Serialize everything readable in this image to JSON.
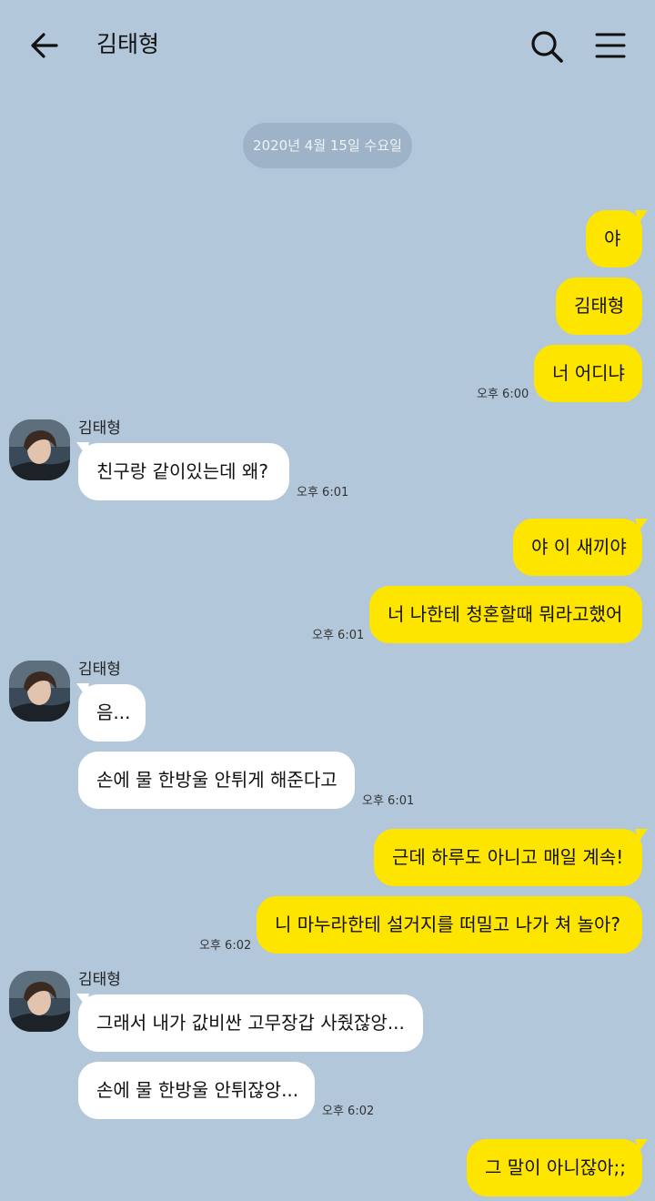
{
  "header": {
    "title": "김태형",
    "back_icon": "arrow-left-icon",
    "search_icon": "search-icon",
    "menu_icon": "hamburger-menu-icon"
  },
  "date_divider": "2020년 4월 15일 수요일",
  "colors": {
    "background": "#b2c7da",
    "my_bubble": "#fee500",
    "their_bubble": "#ffffff",
    "date_pill": "#9eb3c7"
  },
  "messages": [
    {
      "from": "me",
      "text": "야"
    },
    {
      "from": "me",
      "text": "김태형"
    },
    {
      "from": "me",
      "text": "너 어디냐",
      "time": "오후 6:00"
    },
    {
      "from": "them",
      "sender": "김태형",
      "text": "친구랑 같이있는데 왜?",
      "time": "오후 6:01"
    },
    {
      "from": "me",
      "text": "야 이 새끼야"
    },
    {
      "from": "me",
      "text": "너 나한테 청혼할때 뭐라고했어",
      "time": "오후 6:01"
    },
    {
      "from": "them",
      "sender": "김태형",
      "text": "음..."
    },
    {
      "from": "them",
      "text": "손에 물 한방울 안튀게 해준다고",
      "time": "오후 6:01"
    },
    {
      "from": "me",
      "text": "근데 하루도 아니고 매일 계속!"
    },
    {
      "from": "me",
      "text": "니 마누라한테 설거지를 떠밀고 나가 쳐 놀아?",
      "time": "오후 6:02"
    },
    {
      "from": "them",
      "sender": "김태형",
      "text": "그래서 내가 값비싼 고무장갑 사줬잖앙..."
    },
    {
      "from": "them",
      "text": "손에 물 한방울 안튀잖앙...",
      "time": "오후 6:02"
    },
    {
      "from": "me",
      "text": "그 말이 아니잖아;;"
    }
  ]
}
